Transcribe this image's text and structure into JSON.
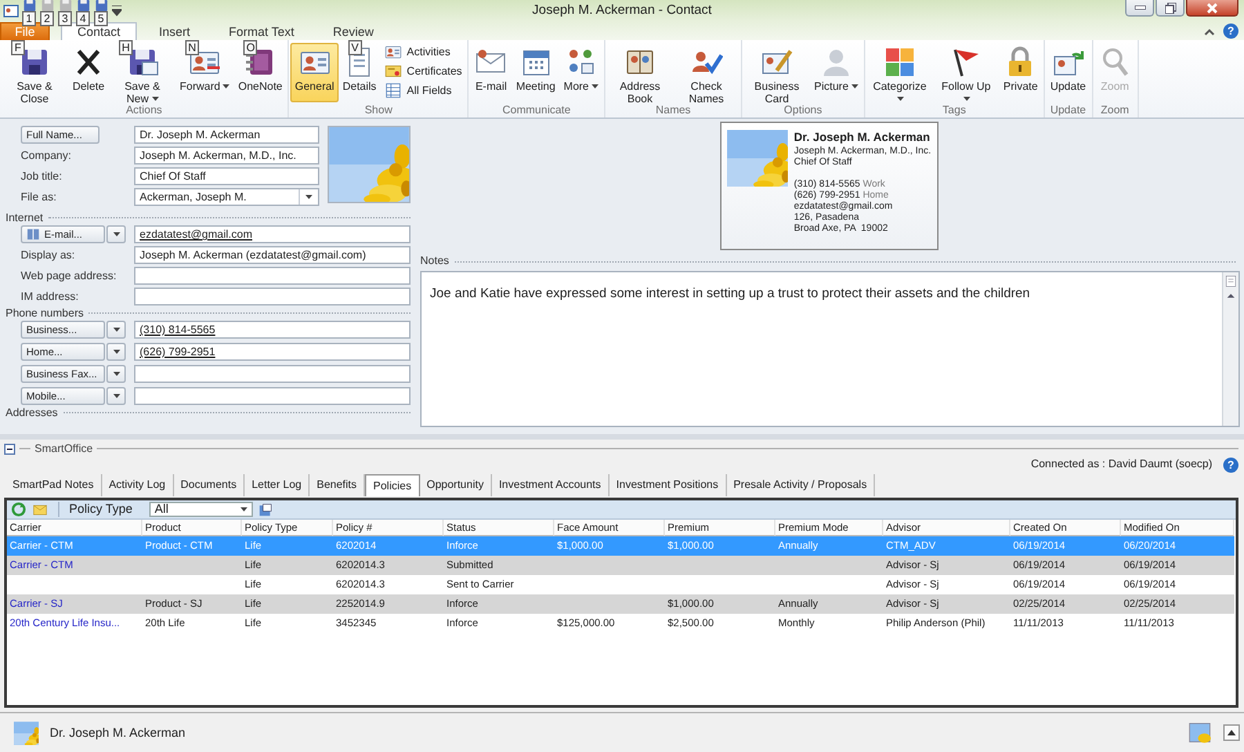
{
  "window": {
    "title": "Joseph M. Ackerman - Contact",
    "help": "?"
  },
  "quick_access": [
    {
      "keytip": "1",
      "disabled": false
    },
    {
      "keytip": "2",
      "disabled": true
    },
    {
      "keytip": "3",
      "disabled": true
    },
    {
      "keytip": "4",
      "disabled": false
    },
    {
      "keytip": "5",
      "disabled": false
    }
  ],
  "ribbon_tabs": [
    {
      "label": "File",
      "kind": "file",
      "selected": false
    },
    {
      "label": "Contact",
      "kind": "tab",
      "selected": true
    },
    {
      "label": "Insert",
      "kind": "tab",
      "selected": false
    },
    {
      "label": "Format Text",
      "kind": "tab",
      "selected": false
    },
    {
      "label": "Review",
      "kind": "tab",
      "selected": false
    }
  ],
  "ribbon_groups": [
    {
      "label": "Actions",
      "buttons": [
        {
          "label": "Save & Close",
          "kind": "large",
          "keytip": "F"
        },
        {
          "label": "Delete",
          "kind": "large"
        },
        {
          "label": "Save & New",
          "kind": "large",
          "dropdown": true,
          "keytip": "H"
        },
        {
          "label": "Forward",
          "kind": "large",
          "dropdown": true,
          "keytip": "N"
        },
        {
          "label": "OneNote",
          "kind": "large",
          "keytip": "O"
        }
      ]
    },
    {
      "label": "Show",
      "buttons": [
        {
          "label": "General",
          "kind": "large",
          "selected": true
        },
        {
          "label": "Details",
          "kind": "large",
          "keytip": "V",
          "selected": false
        },
        {
          "label": "Activities",
          "kind": "small",
          "selected": false
        },
        {
          "label": "Certificates",
          "kind": "small",
          "selected": false
        },
        {
          "label": "All Fields",
          "kind": "small",
          "selected": false
        }
      ]
    },
    {
      "label": "Communicate",
      "buttons": [
        {
          "label": "E-mail",
          "kind": "large"
        },
        {
          "label": "Meeting",
          "kind": "large"
        },
        {
          "label": "More",
          "kind": "large",
          "dropdown": true
        }
      ]
    },
    {
      "label": "Names",
      "buttons": [
        {
          "label": "Address Book",
          "kind": "large"
        },
        {
          "label": "Check Names",
          "kind": "large"
        }
      ]
    },
    {
      "label": "Options",
      "buttons": [
        {
          "label": "Business Card",
          "kind": "large"
        },
        {
          "label": "Picture",
          "kind": "large",
          "dropdown": true
        }
      ]
    },
    {
      "label": "Tags",
      "buttons": [
        {
          "label": "Categorize",
          "kind": "large",
          "dropdown": true
        },
        {
          "label": "Follow Up",
          "kind": "large",
          "dropdown": true
        },
        {
          "label": "Private",
          "kind": "large"
        }
      ]
    },
    {
      "label": "Update",
      "buttons": [
        {
          "label": "Update",
          "kind": "large"
        }
      ]
    },
    {
      "label": "Zoom",
      "buttons": [
        {
          "label": "Zoom",
          "kind": "large",
          "disabled": true
        }
      ]
    }
  ],
  "contact": {
    "fields": [
      {
        "kind": "button",
        "label": "Full Name...",
        "value": "Dr. Joseph M. Ackerman"
      },
      {
        "kind": "text",
        "label": "Company:",
        "value": "Joseph M. Ackerman, M.D., Inc."
      },
      {
        "kind": "text",
        "label": "Job title:",
        "value": "Chief Of Staff"
      },
      {
        "kind": "combo",
        "label": "File as:",
        "value": "Ackerman, Joseph M."
      }
    ],
    "sections": [
      {
        "title": "Internet",
        "fields": [
          {
            "kind": "split",
            "label": "E-mail...",
            "value": "ezdatatest@gmail.com",
            "link": true
          },
          {
            "kind": "text",
            "label": "Display as:",
            "value": "Joseph M. Ackerman (ezdatatest@gmail.com)"
          },
          {
            "kind": "text",
            "label": "Web page address:"
          },
          {
            "kind": "text",
            "label": "IM address:"
          }
        ]
      },
      {
        "title": "Phone numbers",
        "fields": [
          {
            "kind": "split",
            "label": "Business...",
            "value": "(310) 814-5565",
            "link": true
          },
          {
            "kind": "split",
            "label": "Home...",
            "value": "(626) 799-2951",
            "link": true
          },
          {
            "kind": "split",
            "label": "Business Fax..."
          },
          {
            "kind": "split",
            "label": "Mobile..."
          }
        ]
      },
      {
        "title": "Addresses"
      }
    ]
  },
  "business_card": {
    "name": "Dr. Joseph M. Ackerman",
    "company": "Joseph M. Ackerman, M.D., Inc.",
    "job_title": "Chief Of Staff",
    "phones": [
      {
        "number": "(310) 814-5565",
        "type": "Work"
      },
      {
        "number": "(626) 799-2951",
        "type": "Home"
      }
    ],
    "email": "ezdatatest@gmail.com",
    "address_lines": [
      "126, Pasadena",
      "Broad Axe, PA  19002"
    ]
  },
  "notes": {
    "label": "Notes",
    "text": "Joe and Katie have expressed some interest in setting up a trust to protect their assets and the children"
  },
  "smartoffice": {
    "title": "SmartOffice",
    "connected": "Connected as : David Daumt (soecp)",
    "help": "?",
    "tabs": [
      {
        "label": "SmartPad Notes",
        "selected": false
      },
      {
        "label": "Activity Log",
        "selected": false
      },
      {
        "label": "Documents",
        "selected": false
      },
      {
        "label": "Letter Log",
        "selected": false
      },
      {
        "label": "Benefits",
        "selected": false
      },
      {
        "label": "Policies",
        "selected": true
      },
      {
        "label": "Opportunity",
        "selected": false
      },
      {
        "label": "Investment Accounts",
        "selected": false
      },
      {
        "label": "Investment Positions",
        "selected": false
      },
      {
        "label": "Presale Activity / Proposals",
        "selected": false
      }
    ],
    "filter": {
      "label": "Policy Type",
      "value": "All"
    },
    "table": {
      "columns": [
        "Carrier",
        "Product",
        "Policy Type",
        "Policy #",
        "Status",
        "Face Amount",
        "Premium",
        "Premium Mode",
        "Advisor",
        "Created On",
        "Modified On"
      ],
      "rows": [
        {
          "selected": true,
          "cells": [
            "Carrier - CTM",
            "Product - CTM",
            "Life",
            "6202014",
            "Inforce",
            "$1,000.00",
            "$1,000.00",
            "Annually",
            "CTM_ADV",
            "06/19/2014",
            "06/20/2014"
          ]
        },
        {
          "selected": false,
          "cells": [
            "Carrier - CTM",
            null,
            "Life",
            "6202014.3",
            "Submitted",
            null,
            null,
            null,
            "Advisor - Sj",
            "06/19/2014",
            "06/19/2014"
          ]
        },
        {
          "selected": false,
          "cells": [
            null,
            null,
            "Life",
            "6202014.3",
            "Sent to Carrier",
            null,
            null,
            null,
            "Advisor - Sj",
            "06/19/2014",
            "06/19/2014"
          ]
        },
        {
          "selected": false,
          "cells": [
            "Carrier - SJ",
            "Product - SJ",
            "Life",
            "2252014.9",
            "Inforce",
            null,
            "$1,000.00",
            "Annually",
            "Advisor - Sj",
            "02/25/2014",
            "02/25/2014"
          ]
        },
        {
          "selected": false,
          "cells": [
            "20th Century Life Insu...",
            "20th Life",
            "Life",
            "3452345",
            "Inforce",
            "$125,000.00",
            "$2,500.00",
            "Monthly",
            "Philip Anderson (Phil)",
            "11/11/2013",
            "11/11/2013"
          ]
        }
      ]
    }
  },
  "status_bar": {
    "contact_name": "Dr. Joseph M. Ackerman"
  }
}
